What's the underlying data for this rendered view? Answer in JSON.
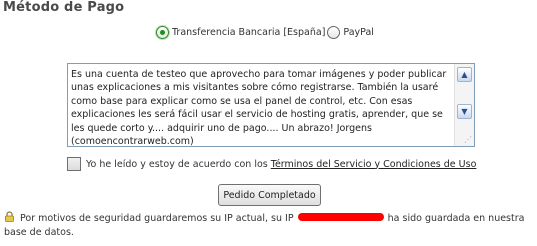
{
  "section": {
    "title": "Método de Pago"
  },
  "payment": {
    "options": [
      {
        "label": "Transferencia Bancaria [España]",
        "selected": true
      },
      {
        "label": "PayPal",
        "selected": false
      }
    ]
  },
  "terms": {
    "text": "Es una cuenta de testeo que aprovecho para tomar imágenes y poder publicar unas explicaciones a mis visitantes sobre cómo registrarse. También la usaré como base para explicar como se usa el panel de control, etc. Con esas explicaciones les será fácil usar el servicio de hosting gratis, aprender, que se les quede corto y.... adquirir uno de pago.... Un abrazo! Jorgens (comoencontrarweb.com)"
  },
  "agreement": {
    "checked": false,
    "label": "Yo he leído y estoy de acuerdo con los",
    "link": "Términos del Servicio y Condiciones de Uso"
  },
  "submit": {
    "label": "Pedido Completado"
  },
  "security": {
    "text_before": "Por motivos de seguridad guardaremos su IP actual, su IP",
    "text_after": "ha sido guardada en nuestra base de datos."
  },
  "icons": {
    "lock": "lock-icon",
    "scroll_up": "scroll-up-arrow-icon",
    "scroll_down": "scroll-down-arrow-icon",
    "resize": "resize-grip-icon"
  },
  "colors": {
    "title": "#4a4a4a",
    "radio_selected": "#1f8f1f",
    "textarea_border": "#7f9db9",
    "redaction": "#ff0000"
  }
}
